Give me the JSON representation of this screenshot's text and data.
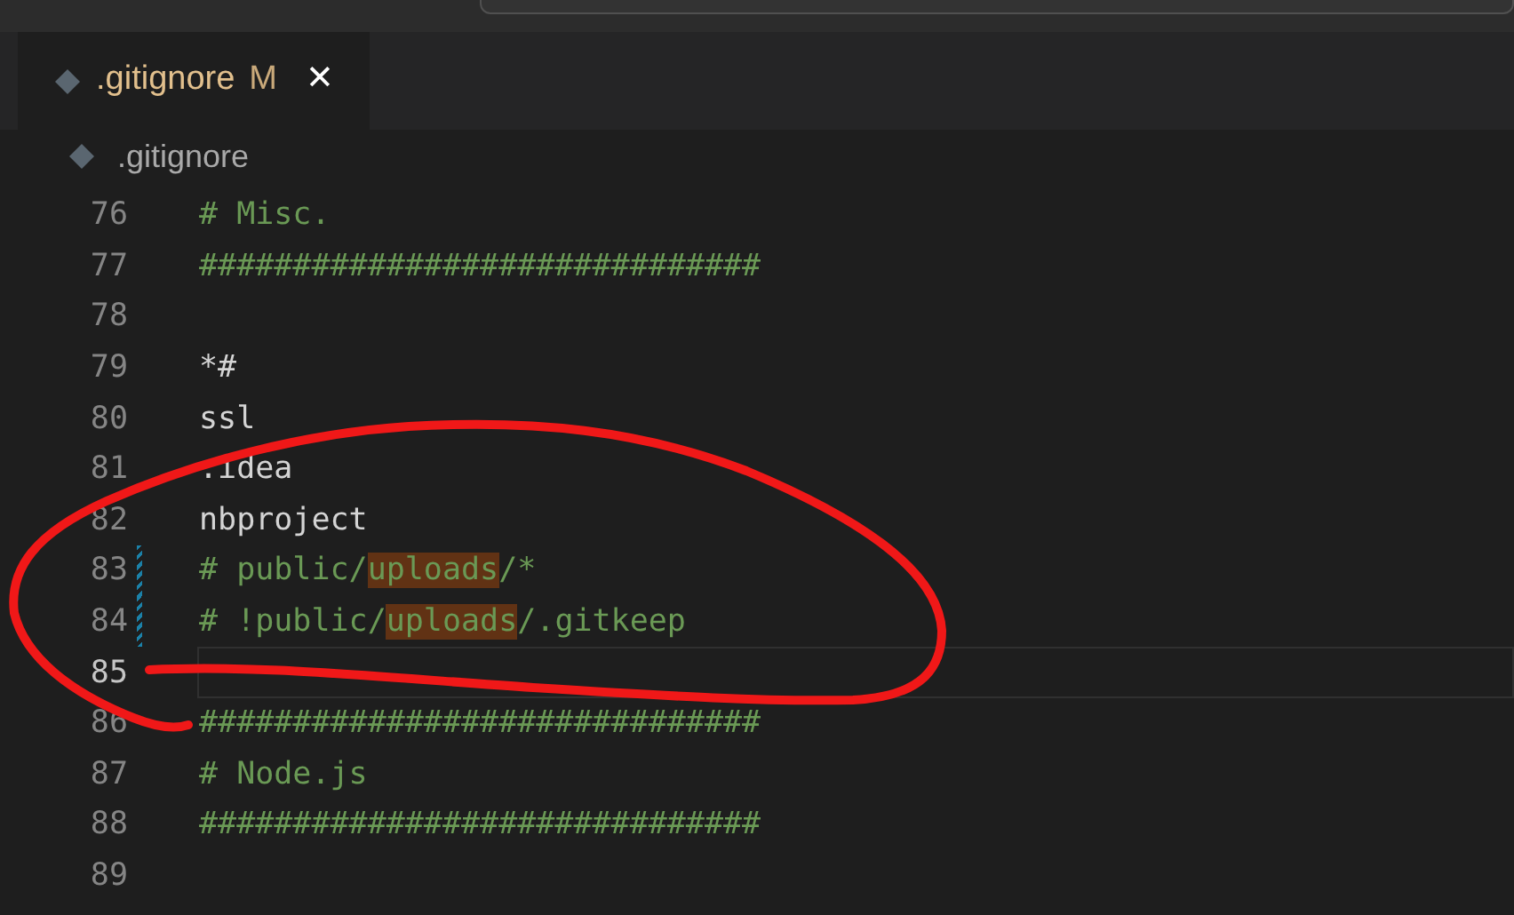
{
  "tabs": [
    {
      "label": ".gitignore",
      "badge": "M",
      "close": "✕",
      "selected": true
    }
  ],
  "breadcrumb": {
    "label": ".gitignore"
  },
  "editor": {
    "lines": [
      {
        "number": "76",
        "kind": "comment",
        "modified": false,
        "current": false,
        "segments": [
          {
            "text": "# Misc.",
            "highlighted": false
          }
        ]
      },
      {
        "number": "77",
        "kind": "comment",
        "modified": false,
        "current": false,
        "segments": [
          {
            "text": "##############################",
            "highlighted": false
          }
        ]
      },
      {
        "number": "78",
        "modified": false,
        "current": false
      },
      {
        "number": "79",
        "kind": "plain",
        "modified": false,
        "current": false,
        "segments": [
          {
            "text": "*#",
            "highlighted": false
          }
        ]
      },
      {
        "number": "80",
        "kind": "plain",
        "modified": false,
        "current": false,
        "segments": [
          {
            "text": "ssl",
            "highlighted": false
          }
        ]
      },
      {
        "number": "81",
        "kind": "plain",
        "modified": false,
        "current": false,
        "segments": [
          {
            "text": ".idea",
            "highlighted": false
          }
        ]
      },
      {
        "number": "82",
        "kind": "plain",
        "modified": false,
        "current": false,
        "segments": [
          {
            "text": "nbproject",
            "highlighted": false
          }
        ]
      },
      {
        "number": "83",
        "kind": "comment",
        "modified": true,
        "current": false,
        "segments": [
          {
            "text": "# public/",
            "highlighted": false
          },
          {
            "text": "uploads",
            "highlighted": true
          },
          {
            "text": "/*",
            "highlighted": false
          }
        ]
      },
      {
        "number": "84",
        "kind": "comment",
        "modified": true,
        "current": false,
        "segments": [
          {
            "text": "# !public/",
            "highlighted": false
          },
          {
            "text": "uploads",
            "highlighted": true
          },
          {
            "text": "/.gitkeep",
            "highlighted": false
          }
        ]
      },
      {
        "number": "85",
        "modified": false,
        "current": true
      },
      {
        "number": "86",
        "kind": "comment",
        "modified": false,
        "current": false,
        "segments": [
          {
            "text": "##############################",
            "highlighted": false
          }
        ]
      },
      {
        "number": "87",
        "kind": "comment",
        "modified": false,
        "current": false,
        "segments": [
          {
            "text": "# Node.js",
            "highlighted": false
          }
        ]
      },
      {
        "number": "88",
        "kind": "comment",
        "modified": false,
        "current": false,
        "segments": [
          {
            "text": "##############################",
            "highlighted": false
          }
        ]
      },
      {
        "number": "89",
        "modified": false,
        "current": false
      }
    ]
  }
}
